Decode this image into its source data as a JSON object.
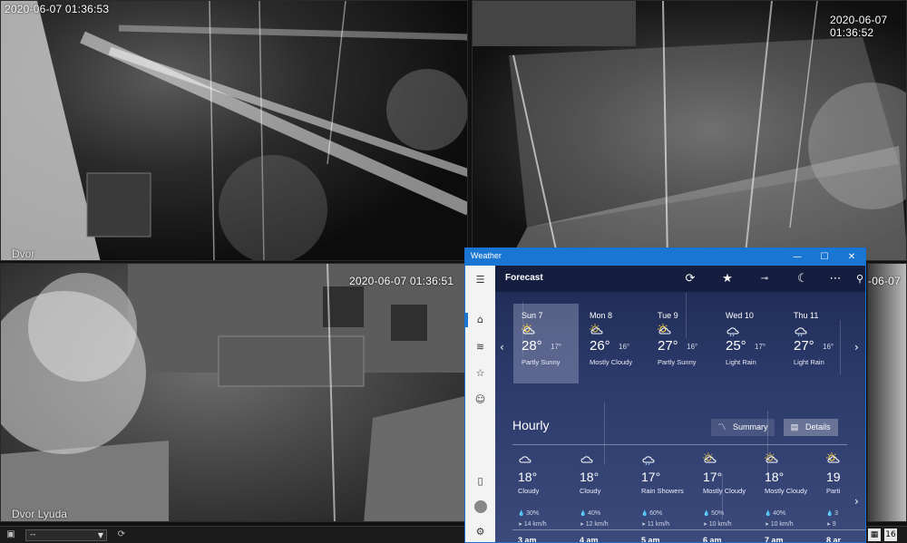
{
  "cameras": [
    {
      "timestamp": "2020-06-07 01:36:53",
      "label": "Dvor"
    },
    {
      "timestamp": "2020-06-07 01:36:52",
      "label": ""
    },
    {
      "timestamp": "2020-06-07 01:36:51",
      "label": "Dvor Lyuda"
    },
    {
      "timestamp": "-06-07",
      "label": ""
    }
  ],
  "toolbar": {
    "camera_select_value": "--",
    "grid_label": "16"
  },
  "weather": {
    "window_title": "Weather",
    "page_title": "Forecast",
    "daily": [
      {
        "day": "Sun 7",
        "high": "28°",
        "low": "17°",
        "condition": "Partly Sunny",
        "icon": "partly-sunny"
      },
      {
        "day": "Mon 8",
        "high": "26°",
        "low": "16°",
        "condition": "Mostly Cloudy",
        "icon": "mostly-cloudy"
      },
      {
        "day": "Tue 9",
        "high": "27°",
        "low": "16°",
        "condition": "Partly Sunny",
        "icon": "partly-sunny"
      },
      {
        "day": "Wed 10",
        "high": "25°",
        "low": "17°",
        "condition": "Light Rain",
        "icon": "light-rain"
      },
      {
        "day": "Thu 11",
        "high": "27°",
        "low": "16°",
        "condition": "Light Rain",
        "icon": "light-rain"
      }
    ],
    "hourly_title": "Hourly",
    "summary_label": "Summary",
    "details_label": "Details",
    "hourly": [
      {
        "temp": "18°",
        "condition": "Cloudy",
        "precip": "30%",
        "wind": "14 km/h",
        "time": "3 am",
        "icon": "cloudy"
      },
      {
        "temp": "18°",
        "condition": "Cloudy",
        "precip": "40%",
        "wind": "12 km/h",
        "time": "4 am",
        "icon": "cloudy"
      },
      {
        "temp": "17°",
        "condition": "Rain Showers",
        "precip": "60%",
        "wind": "11 km/h",
        "time": "5 am",
        "icon": "rain-showers"
      },
      {
        "temp": "17°",
        "condition": "Mostly Cloudy",
        "precip": "50%",
        "wind": "10 km/h",
        "time": "6 am",
        "icon": "mostly-cloudy"
      },
      {
        "temp": "18°",
        "condition": "Mostly Cloudy",
        "precip": "40%",
        "wind": "10 km/h",
        "time": "7 am",
        "icon": "mostly-cloudy"
      },
      {
        "temp": "19",
        "condition": "Parti",
        "precip": "3",
        "wind": "9",
        "time": "8 ar",
        "icon": "partly-sunny"
      }
    ]
  }
}
